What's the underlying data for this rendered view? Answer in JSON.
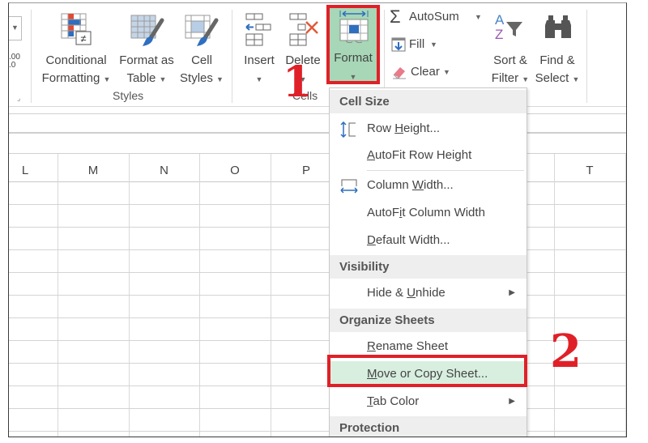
{
  "ribbon": {
    "partial_left": {
      "decimal_label": ".00 .0"
    },
    "styles": {
      "conditional_formatting": {
        "line1": "Conditional",
        "line2": "Formatting"
      },
      "format_as_table": {
        "line1": "Format as",
        "line2": "Table"
      },
      "cell_styles": {
        "line1": "Cell",
        "line2": "Styles"
      },
      "group_label": "Styles"
    },
    "cells": {
      "insert": "Insert",
      "delete": "Delete",
      "format": "Format",
      "group_label": "Cells"
    },
    "editing": {
      "autosum": "AutoSum",
      "fill": "Fill",
      "clear": "Clear",
      "sort_filter": {
        "line1": "Sort &",
        "line2": "Filter"
      },
      "find_select": {
        "line1": "Find &",
        "line2": "Select"
      }
    }
  },
  "grid": {
    "columns": [
      "L",
      "M",
      "N",
      "O",
      "P",
      "T"
    ]
  },
  "format_menu": {
    "sections": [
      {
        "header": "Cell Size",
        "items": [
          {
            "label_pre": "Row ",
            "accel": "H",
            "label_post": "eight...",
            "icon": "row-height-icon"
          },
          {
            "label_pre": "",
            "accel": "A",
            "label_post": "utoFit Row Height"
          },
          {
            "label_pre": "Column ",
            "accel": "W",
            "label_post": "idth...",
            "icon": "column-width-icon"
          },
          {
            "label_pre": "AutoF",
            "accel": "i",
            "label_post": "t Column Width"
          },
          {
            "label_pre": "",
            "accel": "D",
            "label_post": "efault Width..."
          }
        ]
      },
      {
        "header": "Visibility",
        "items": [
          {
            "label_pre": "Hide & ",
            "accel": "U",
            "label_post": "nhide",
            "submenu": true
          }
        ]
      },
      {
        "header": "Organize Sheets",
        "items": [
          {
            "label_pre": "",
            "accel": "R",
            "label_post": "ename Sheet"
          },
          {
            "label_pre": "",
            "accel": "M",
            "label_post": "ove or Copy Sheet...",
            "highlighted": true
          },
          {
            "label_pre": "",
            "accel": "T",
            "label_post": "ab Color",
            "submenu": true
          }
        ]
      },
      {
        "header": "Protection",
        "items": []
      }
    ]
  },
  "annotations": {
    "step1": "1",
    "step2": "2"
  },
  "colors": {
    "highlight_red": "#e02028",
    "format_green": "#a7d7b6",
    "menu_hover": "#d8efe0"
  }
}
